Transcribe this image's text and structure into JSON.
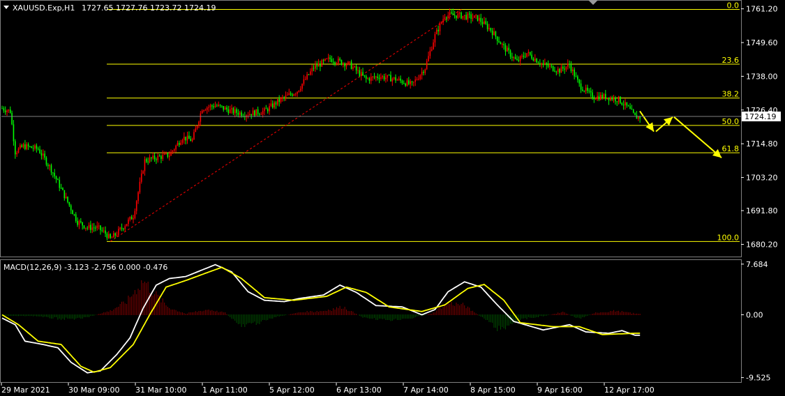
{
  "header": {
    "symbol": "XAUUSD.Exp,H1",
    "ohlc": "1727.65 1727.76 1723.72 1724.19"
  },
  "macd": {
    "label": "MACD(12,26,9) -3.123 -2.756 0.000 -0.476"
  },
  "colors": {
    "background": "#000000",
    "bull": "#ff0000",
    "bear": "#00ff00",
    "fib": "#ffff00",
    "macd_main": "#ffffff",
    "macd_signal": "#ffff00",
    "grid": "#808080"
  },
  "icons": {
    "dropdown": "triangle-down-icon"
  },
  "chart_data": [
    {
      "type": "candlestick",
      "symbol": "XAUUSD.Exp",
      "timeframe": "H1",
      "ylim": [
        1676.0,
        1764.0
      ],
      "y_ticks": [
        "1761.20",
        "1749.60",
        "1738.00",
        "1726.40",
        "1714.80",
        "1703.20",
        "1691.80",
        "1680.20"
      ],
      "y_tick_values": [
        1761.2,
        1749.6,
        1738.0,
        1726.4,
        1714.8,
        1703.2,
        1691.8,
        1680.2
      ],
      "x_ticks": [
        "29 Mar 2021",
        "30 Mar 09:00",
        "31 Mar 10:00",
        "1 Apr 11:00",
        "5 Apr 12:00",
        "6 Apr 13:00",
        "7 Apr 14:00",
        "8 Apr 15:00",
        "9 Apr 16:00",
        "12 Apr 17:00"
      ],
      "current_price": "1724.19",
      "current_price_value": 1724.19,
      "fibonacci": {
        "high": 1761.0,
        "low": 1681.2,
        "levels": [
          {
            "label": "0.0",
            "ratio": 0.0
          },
          {
            "label": "23.6",
            "ratio": 0.236
          },
          {
            "label": "38.2",
            "ratio": 0.382
          },
          {
            "label": "50.0",
            "ratio": 0.5
          },
          {
            "label": "61.8",
            "ratio": 0.618
          },
          {
            "label": "100.0",
            "ratio": 1.0
          }
        ]
      },
      "trendline": {
        "from": [
          1681.2
        ],
        "to": [
          1761.0
        ]
      },
      "forecast_arrows": [
        {
          "from": 1726.0,
          "to": 1719.0
        },
        {
          "from": 1719.0,
          "to": 1724.0
        },
        {
          "from": 1724.0,
          "to": 1710.0
        }
      ],
      "anchors": [
        {
          "t": 0,
          "p": 1727
        },
        {
          "t": 5,
          "p": 1726
        },
        {
          "t": 8,
          "p": 1712
        },
        {
          "t": 13,
          "p": 1714
        },
        {
          "t": 22,
          "p": 1713
        },
        {
          "t": 30,
          "p": 1706
        },
        {
          "t": 38,
          "p": 1697
        },
        {
          "t": 46,
          "p": 1688
        },
        {
          "t": 52,
          "p": 1686
        },
        {
          "t": 58,
          "p": 1686
        },
        {
          "t": 63,
          "p": 1684
        },
        {
          "t": 66,
          "p": 1682
        },
        {
          "t": 70,
          "p": 1684
        },
        {
          "t": 80,
          "p": 1690
        },
        {
          "t": 87,
          "p": 1709
        },
        {
          "t": 94,
          "p": 1710
        },
        {
          "t": 102,
          "p": 1711
        },
        {
          "t": 110,
          "p": 1717
        },
        {
          "t": 116,
          "p": 1716
        },
        {
          "t": 122,
          "p": 1727
        },
        {
          "t": 130,
          "p": 1728
        },
        {
          "t": 140,
          "p": 1726
        },
        {
          "t": 148,
          "p": 1725
        },
        {
          "t": 160,
          "p": 1726
        },
        {
          "t": 170,
          "p": 1730
        },
        {
          "t": 180,
          "p": 1733
        },
        {
          "t": 190,
          "p": 1741
        },
        {
          "t": 200,
          "p": 1744
        },
        {
          "t": 212,
          "p": 1742
        },
        {
          "t": 222,
          "p": 1737
        },
        {
          "t": 230,
          "p": 1738
        },
        {
          "t": 240,
          "p": 1737
        },
        {
          "t": 250,
          "p": 1735
        },
        {
          "t": 258,
          "p": 1741
        },
        {
          "t": 264,
          "p": 1752
        },
        {
          "t": 270,
          "p": 1759
        },
        {
          "t": 278,
          "p": 1759
        },
        {
          "t": 290,
          "p": 1758
        },
        {
          "t": 298,
          "p": 1754
        },
        {
          "t": 306,
          "p": 1748
        },
        {
          "t": 314,
          "p": 1743
        },
        {
          "t": 320,
          "p": 1746
        },
        {
          "t": 330,
          "p": 1742
        },
        {
          "t": 340,
          "p": 1740
        },
        {
          "t": 346,
          "p": 1742
        },
        {
          "t": 352,
          "p": 1735
        },
        {
          "t": 360,
          "p": 1731
        },
        {
          "t": 368,
          "p": 1731
        },
        {
          "t": 376,
          "p": 1730
        },
        {
          "t": 382,
          "p": 1727
        },
        {
          "t": 386,
          "p": 1724
        }
      ]
    },
    {
      "type": "line",
      "title": "MACD(12,26,9)",
      "ylim": [
        -10.2,
        8.3
      ],
      "y_ticks": [
        "7.684",
        "0.00",
        "-9.525"
      ],
      "y_tick_values": [
        7.684,
        0.0,
        -9.525
      ],
      "series": [
        {
          "name": "main",
          "anchors": [
            {
              "t": 0,
              "v": -0.5
            },
            {
              "t": 8,
              "v": -1.5
            },
            {
              "t": 14,
              "v": -4.0
            },
            {
              "t": 25,
              "v": -4.5
            },
            {
              "t": 34,
              "v": -5.0
            },
            {
              "t": 42,
              "v": -7.2
            },
            {
              "t": 52,
              "v": -8.8
            },
            {
              "t": 60,
              "v": -8.5
            },
            {
              "t": 70,
              "v": -6.0
            },
            {
              "t": 78,
              "v": -3.5
            },
            {
              "t": 86,
              "v": 1.0
            },
            {
              "t": 94,
              "v": 4.5
            },
            {
              "t": 102,
              "v": 5.5
            },
            {
              "t": 112,
              "v": 5.8
            },
            {
              "t": 122,
              "v": 6.8
            },
            {
              "t": 130,
              "v": 7.6
            },
            {
              "t": 140,
              "v": 6.5
            },
            {
              "t": 150,
              "v": 3.5
            },
            {
              "t": 160,
              "v": 2.2
            },
            {
              "t": 172,
              "v": 2.0
            },
            {
              "t": 182,
              "v": 2.5
            },
            {
              "t": 196,
              "v": 3.0
            },
            {
              "t": 206,
              "v": 4.5
            },
            {
              "t": 216,
              "v": 3.4
            },
            {
              "t": 228,
              "v": 1.4
            },
            {
              "t": 244,
              "v": 1.2
            },
            {
              "t": 256,
              "v": 0.0
            },
            {
              "t": 264,
              "v": 0.8
            },
            {
              "t": 272,
              "v": 3.5
            },
            {
              "t": 282,
              "v": 5.0
            },
            {
              "t": 292,
              "v": 4.2
            },
            {
              "t": 302,
              "v": 1.5
            },
            {
              "t": 312,
              "v": -1.0
            },
            {
              "t": 330,
              "v": -2.3
            },
            {
              "t": 346,
              "v": -1.5
            },
            {
              "t": 356,
              "v": -2.6
            },
            {
              "t": 370,
              "v": -2.8
            },
            {
              "t": 378,
              "v": -2.4
            },
            {
              "t": 386,
              "v": -3.1
            }
          ]
        },
        {
          "name": "signal",
          "anchors": [
            {
              "t": 0,
              "v": 0.0
            },
            {
              "t": 10,
              "v": -1.5
            },
            {
              "t": 22,
              "v": -4.0
            },
            {
              "t": 36,
              "v": -4.5
            },
            {
              "t": 48,
              "v": -7.8
            },
            {
              "t": 56,
              "v": -8.7
            },
            {
              "t": 66,
              "v": -8.0
            },
            {
              "t": 80,
              "v": -4.5
            },
            {
              "t": 90,
              "v": 0.0
            },
            {
              "t": 100,
              "v": 4.2
            },
            {
              "t": 112,
              "v": 5.2
            },
            {
              "t": 124,
              "v": 6.3
            },
            {
              "t": 134,
              "v": 7.2
            },
            {
              "t": 146,
              "v": 5.5
            },
            {
              "t": 160,
              "v": 2.6
            },
            {
              "t": 178,
              "v": 2.2
            },
            {
              "t": 198,
              "v": 2.8
            },
            {
              "t": 210,
              "v": 4.2
            },
            {
              "t": 222,
              "v": 3.4
            },
            {
              "t": 236,
              "v": 1.2
            },
            {
              "t": 256,
              "v": 0.5
            },
            {
              "t": 270,
              "v": 1.5
            },
            {
              "t": 284,
              "v": 4.0
            },
            {
              "t": 294,
              "v": 4.6
            },
            {
              "t": 306,
              "v": 2.2
            },
            {
              "t": 316,
              "v": -1.2
            },
            {
              "t": 336,
              "v": -1.8
            },
            {
              "t": 352,
              "v": -1.8
            },
            {
              "t": 366,
              "v": -3.0
            },
            {
              "t": 386,
              "v": -2.8
            }
          ]
        }
      ],
      "histogram_anchors": [
        {
          "t": 0,
          "v": -0.2
        },
        {
          "t": 20,
          "v": -0.2
        },
        {
          "t": 35,
          "v": -0.6
        },
        {
          "t": 48,
          "v": -0.6
        },
        {
          "t": 56,
          "v": -0.1
        },
        {
          "t": 66,
          "v": 0.6
        },
        {
          "t": 76,
          "v": 2.0
        },
        {
          "t": 86,
          "v": 5.2
        },
        {
          "t": 94,
          "v": 3.0
        },
        {
          "t": 102,
          "v": 1.0
        },
        {
          "t": 112,
          "v": 0.2
        },
        {
          "t": 126,
          "v": 0.8
        },
        {
          "t": 136,
          "v": 0.3
        },
        {
          "t": 146,
          "v": -1.8
        },
        {
          "t": 156,
          "v": -1.2
        },
        {
          "t": 168,
          "v": -0.3
        },
        {
          "t": 182,
          "v": 0.4
        },
        {
          "t": 196,
          "v": 0.6
        },
        {
          "t": 208,
          "v": 1.2
        },
        {
          "t": 220,
          "v": -0.4
        },
        {
          "t": 236,
          "v": -0.8
        },
        {
          "t": 250,
          "v": -0.5
        },
        {
          "t": 262,
          "v": 0.2
        },
        {
          "t": 272,
          "v": 1.8
        },
        {
          "t": 282,
          "v": 1.4
        },
        {
          "t": 294,
          "v": -0.6
        },
        {
          "t": 304,
          "v": -2.4
        },
        {
          "t": 314,
          "v": -0.8
        },
        {
          "t": 330,
          "v": -0.2
        },
        {
          "t": 342,
          "v": 0.4
        },
        {
          "t": 352,
          "v": -0.6
        },
        {
          "t": 362,
          "v": 0.3
        },
        {
          "t": 374,
          "v": 0.6
        },
        {
          "t": 386,
          "v": 0.2
        }
      ]
    }
  ]
}
